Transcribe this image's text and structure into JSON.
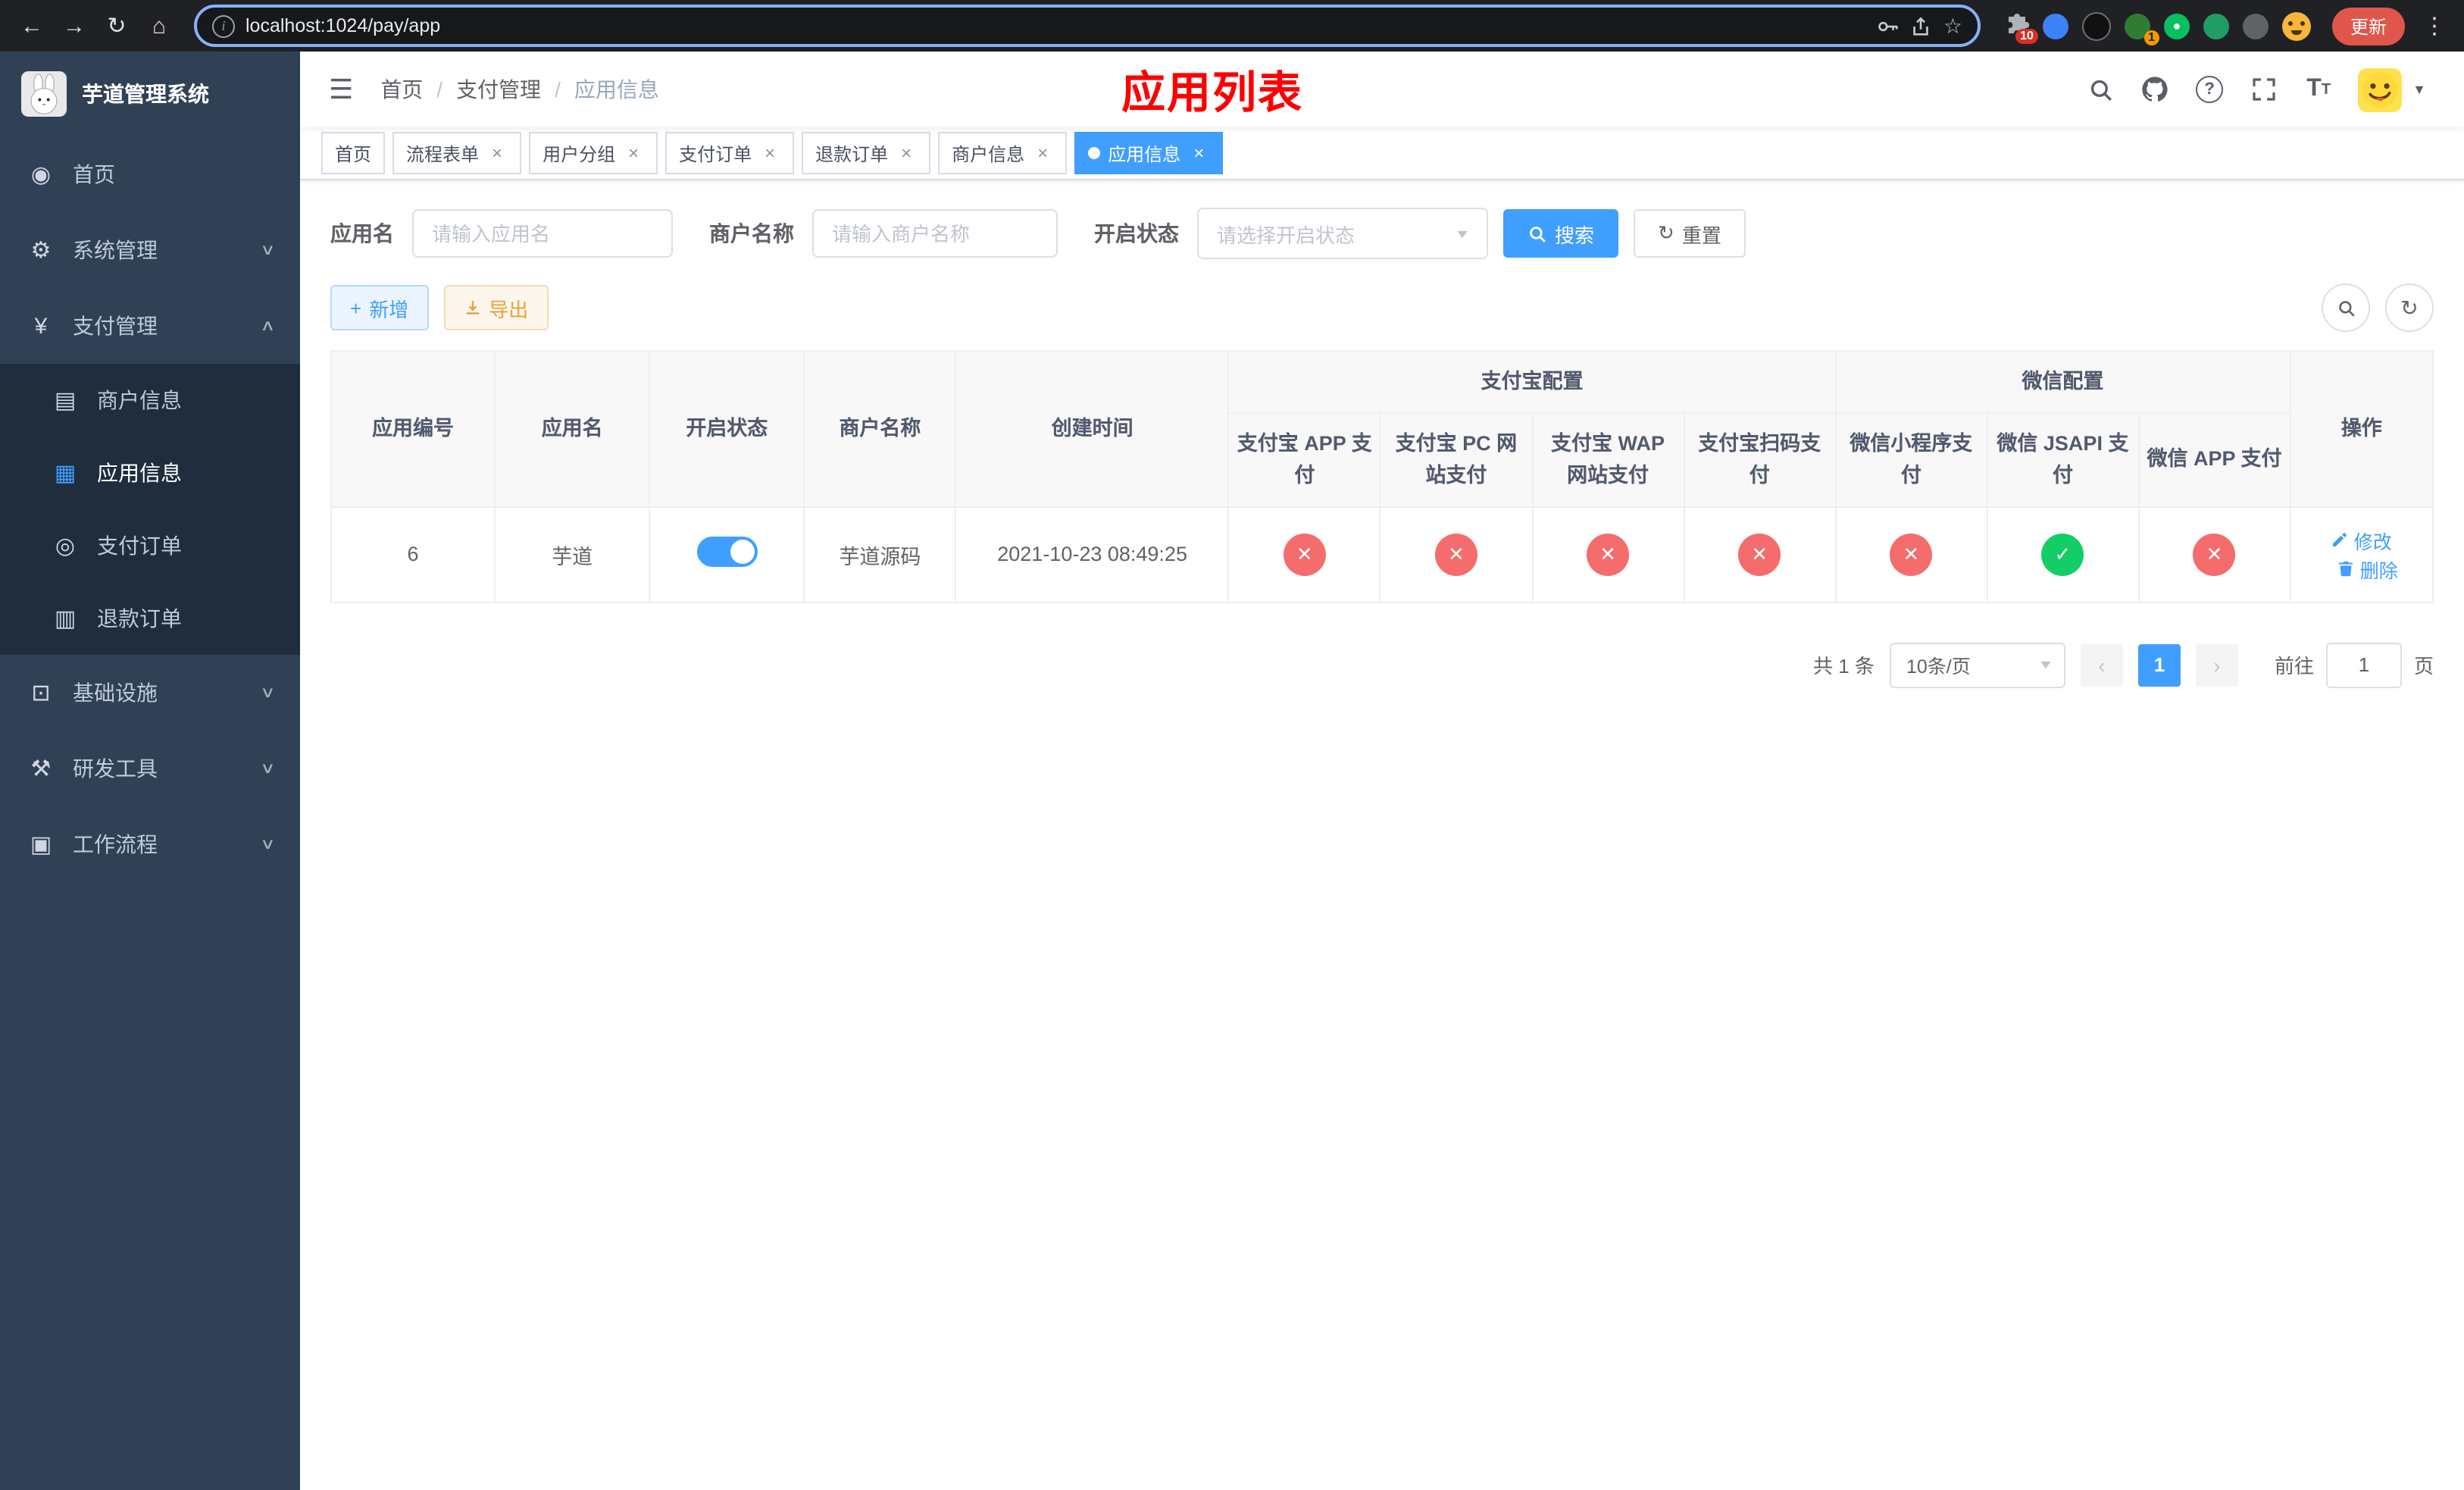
{
  "browser": {
    "url": "localhost:1024/pay/app",
    "update_button": "更新",
    "puzzle_badge": "10",
    "ext_badge": "1"
  },
  "glyphs": {
    "back": "←",
    "forward": "→",
    "reload": "↻",
    "home": "⌂",
    "info": "i",
    "star": "☆",
    "menu_dots": "⋮",
    "hamburger": "☰",
    "close": "×",
    "caret_down": "▼",
    "check": "✓",
    "cross": "✕",
    "plus": "+",
    "refresh": "↻",
    "arrow_left": "‹",
    "arrow_right": "›",
    "question": "?",
    "font_big": "T",
    "font_small": "T"
  },
  "sidebar": {
    "logo_title": "芋道管理系统",
    "menu": [
      {
        "label": "首页",
        "glyph": "◉"
      },
      {
        "label": "系统管理",
        "glyph": "⚙",
        "chevron": "∨"
      },
      {
        "label": "支付管理",
        "glyph": "¥",
        "chevron": "∧"
      },
      {
        "label": "基础设施",
        "glyph": "⊡",
        "chevron": "∨"
      },
      {
        "label": "研发工具",
        "glyph": "⚒",
        "chevron": "∨"
      },
      {
        "label": "工作流程",
        "glyph": "▣",
        "chevron": "∨"
      }
    ],
    "submenu": [
      {
        "label": "商户信息",
        "glyph": "▤"
      },
      {
        "label": "应用信息",
        "glyph": "▦"
      },
      {
        "label": "支付订单",
        "glyph": "◎"
      },
      {
        "label": "退款订单",
        "glyph": "▥"
      }
    ]
  },
  "navbar": {
    "breadcrumb": [
      "首页",
      "支付管理",
      "应用信息"
    ],
    "separator": "/",
    "page_title": "应用列表"
  },
  "tabs": [
    {
      "label": "首页"
    },
    {
      "label": "流程表单"
    },
    {
      "label": "用户分组"
    },
    {
      "label": "支付订单"
    },
    {
      "label": "退款订单"
    },
    {
      "label": "商户信息"
    },
    {
      "label": "应用信息"
    }
  ],
  "filter": {
    "app_name_label": "应用名",
    "app_name_placeholder": "请输入应用名",
    "merchant_label": "商户名称",
    "merchant_placeholder": "请输入商户名称",
    "status_label": "开启状态",
    "status_placeholder": "请选择开启状态",
    "search_button": "搜索",
    "reset_button": "重置"
  },
  "toolbar": {
    "add_button": "新增",
    "export_button": "导出"
  },
  "table": {
    "col_app_id": "应用编号",
    "col_app_name": "应用名",
    "col_status": "开启状态",
    "col_merchant": "商户名称",
    "col_created": "创建时间",
    "group_alipay": "支付宝配置",
    "group_wechat": "微信配置",
    "col_alipay_app": "支付宝 APP 支付",
    "col_alipay_pc": "支付宝 PC 网站支付",
    "col_alipay_wap": "支付宝 WAP 网站支付",
    "col_alipay_qr": "支付宝扫码支付",
    "col_wx_mini": "微信小程序支付",
    "col_wx_jsapi": "微信 JSAPI 支付",
    "col_wx_app": "微信 APP 支付",
    "col_actions": "操作",
    "row": {
      "app_id": "6",
      "app_name": "芋道",
      "status": "on",
      "merchant": "芋道源码",
      "created": "2021-10-23 08:49:25",
      "alipay_app": {
        "state": "disabled",
        "glyph": "✕"
      },
      "alipay_pc": {
        "state": "disabled",
        "glyph": "✕"
      },
      "alipay_wap": {
        "state": "disabled",
        "glyph": "✕"
      },
      "alipay_qr": {
        "state": "disabled",
        "glyph": "✕"
      },
      "wx_mini": {
        "state": "disabled",
        "glyph": "✕"
      },
      "wx_jsapi": {
        "state": "enabled",
        "glyph": "✓"
      },
      "wx_app": {
        "state": "disabled",
        "glyph": "✕"
      },
      "edit_label": "修改",
      "delete_label": "删除"
    }
  },
  "pagination": {
    "total": "共 1 条",
    "page_size": "10条/页",
    "current_page": "1",
    "goto_label": "前往",
    "goto_value": "1",
    "page_label": "页"
  },
  "colors": {
    "accent": "#409eff",
    "danger": "#f56c6c",
    "success": "#13ce66",
    "warning": "#e6a23c",
    "title_red": "#ff0000",
    "sidebar_bg": "#304156",
    "submenu_bg": "#1f2d3d"
  }
}
